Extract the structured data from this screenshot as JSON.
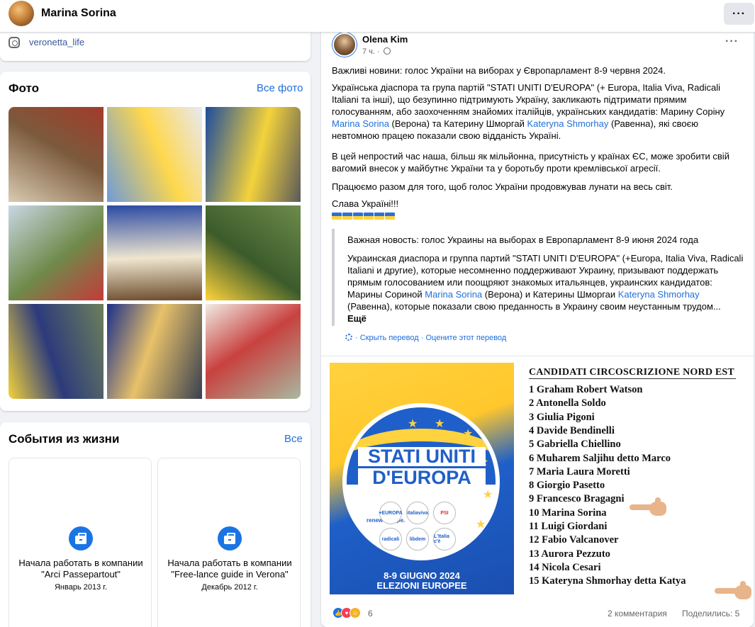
{
  "header": {
    "profile_name": "Marina Sorina",
    "more_label": "···"
  },
  "intro": {
    "instagram": "veronetta_life"
  },
  "photos": {
    "title": "Фото",
    "all_link": "Все фото",
    "items": [
      {
        "colors": [
          "#d9cbb1",
          "#7b5a3c",
          "#a33b2b"
        ]
      },
      {
        "colors": [
          "#6f9bd6",
          "#ffd84d",
          "#e8e8f2"
        ]
      },
      {
        "colors": [
          "#1d4c9c",
          "#f3d23c",
          "#5a5a5a"
        ]
      },
      {
        "colors": [
          "#c9d7e3",
          "#6f8a4a",
          "#c43b3b"
        ]
      },
      {
        "colors": [
          "#2b4aa3",
          "#efe6cf",
          "#6b4b2b"
        ]
      },
      {
        "colors": [
          "#6d8b4b",
          "#3b5b2b",
          "#ffd43b"
        ]
      },
      {
        "colors": [
          "#6d7f5a",
          "#2c3b7b",
          "#f3d23c"
        ]
      },
      {
        "colors": [
          "#394050",
          "#e8c16a",
          "#1b2f8a"
        ]
      },
      {
        "colors": [
          "#a9b8a0",
          "#c8413f",
          "#f0ece3"
        ]
      }
    ]
  },
  "events": {
    "title": "События из жизни",
    "all_link": "Все",
    "items": [
      {
        "title": "Начала работать в компании \"Arci Passepartout\"",
        "date": "Январь 2013 г."
      },
      {
        "title": "Начала работать в компании \"Free-lance guide in Verona\"",
        "date": "Декабрь 2012 г."
      }
    ]
  },
  "post": {
    "author": "Olena Kim",
    "time": "7 ч. ·",
    "more_label": "···",
    "paragraphs": {
      "p1": "Важливі новини: голос України на виборах у Європарламент 8-9 червня 2024.",
      "p2a": "Українська діаспора та група партій \"STATI UNITI D'EUROPA\" (+ Europa, Italia Viva, Radicali Italiani та інші), що безупинно підтримують Україну, закликають підтримати прямим голосуванням, або заохоченням знайомих італійців, українських кандидатів: Марину Соріну ",
      "p2link1": "Marina Sorina",
      "p2b": " (Верона) та Катерину Шморгай ",
      "p2link2": "Kateryna Shmorhay",
      "p2c": " (Равенна), які своєю невтомною працею показали свою відданість Україні.",
      "p3": "В цей непростий час наша, більш як мільйонна, присутність у країнах ЄС, може зробити свій вагомий внесок у майбутнє України та у боротьбу проти кремлівської агресії.",
      "p4": "Працюємо разом для того, щоб голос України продовжував лунати на весь світ.",
      "p5": "Слава Україні!!!"
    },
    "translation": {
      "q1": "Важная новость: голос Украины на выборах в Европарламент 8-9 июня 2024 года",
      "q2a": "Украинская диаспора и группа партий \"STATI UNITI D'EUROPA\" (+Europa, Italia Viva, Radicali Italiani и другие), которые несомненно поддерживают Украину, призывают поддержать прямым голосованием или поощряют знакомых итальянцев, украинских кандидатов: Марины Сориной ",
      "q2link1": "Marina Sorina",
      "q2b": " (Верона) и Катерины Шморгаи ",
      "q2link2": "Kateryna Shmorhay",
      "q2c": " (Равенна), которые показали свою преданность в Украину своим неустанным трудом...",
      "more": "Ещё"
    },
    "translate_links": {
      "hide": "Скрыть перевод",
      "sep": "·",
      "rate": "Оцените этот перевод"
    },
    "poster": {
      "brand_line1": "STATI UNITI",
      "brand_line2": "D'EUROPA",
      "logo_labels": [
        "+EUROPA",
        "italiaviva",
        "PSI",
        "radicali",
        "libdem",
        "L'Italia c'è"
      ],
      "renew": "renew europe.",
      "date_line1": "8-9 GIUGNO 2024",
      "date_line2": "ELEZIONI EUROPEE"
    },
    "candidates": {
      "title": "CANDIDATI CIRCOSCRIZIONE NORD EST",
      "list": [
        "1 Graham Robert Watson",
        "2 Antonella Soldo",
        "3 Giulia Pigoni",
        "4 Davide Bendinelli",
        "5 Gabriella Chiellino",
        "6 Muharem Saljihu detto Marco",
        "7 Maria Laura Moretti",
        "8 Giorgio Pasetto",
        "9 Francesco Bragagni",
        "10 Marina Sorina",
        "11 Luigi Giordani",
        "12 Fabio Valcanover",
        "13 Aurora Pezzuto",
        "14 Nicola Cesari",
        "15 Kateryna Shmorhay detta Katya"
      ]
    },
    "footer": {
      "reaction_count": "6",
      "comments": "2 комментария",
      "shares": "Поделились: 5"
    }
  }
}
